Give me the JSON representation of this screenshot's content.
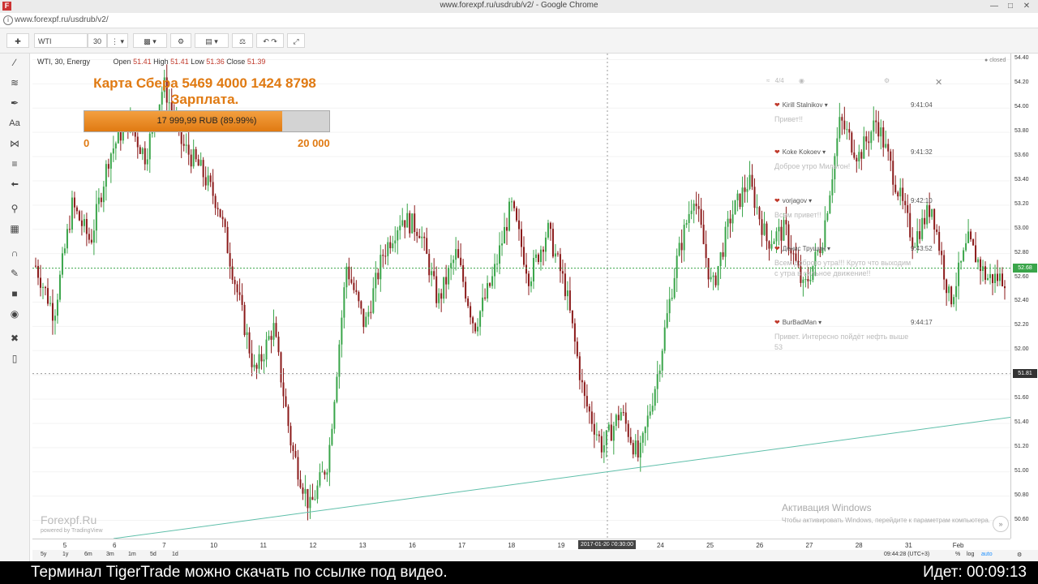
{
  "window": {
    "title": "www.forexpf.ru/usdrub/v2/ - Google Chrome",
    "url": "www.forexpf.ru/usdrub/v2/",
    "favicon": "F"
  },
  "toolbar": {
    "symbol": "WTI",
    "interval": "30"
  },
  "legend": {
    "title": "WTI, 30, Energy",
    "open_label": "Open",
    "open": "51.41",
    "high_label": "High",
    "high": "51.41",
    "low_label": "Low",
    "low": "51.36",
    "close_label": "Close",
    "close": "51.39",
    "status": "closed"
  },
  "overlay": {
    "line1": "Карта Сбера 5469 4000 1424 8798",
    "line2": "Зарплата.",
    "progress_text": "17 999,99 RUB (89.99%)",
    "progress_fraction": 0.8999,
    "min": "0",
    "max": "20 000"
  },
  "chat": {
    "header_count": "4/4",
    "messages": [
      {
        "name": "Kirill Stalnikov",
        "time": "9:41:04",
        "text": "Привет!!"
      },
      {
        "name": "Koke Kokoev",
        "time": "9:41:32",
        "text": "Доброе утро Мильтон!"
      },
      {
        "name": "vorjagov",
        "time": "9:42:10",
        "text": "Всем привет!!"
      },
      {
        "name": "Денис Трушин",
        "time": "9:43:52",
        "text": "Всем доброго утра!!! Круто что выходим с утра в сильное движение!!"
      },
      {
        "name": "BurBadMan",
        "time": "9:44:17",
        "text": "Привет. Интересно пойдёт нефть выше 53"
      }
    ]
  },
  "chart_data": {
    "type": "candlestick",
    "symbol": "WTI",
    "interval": "30",
    "ylim": [
      50.45,
      54.45
    ],
    "y_ticks": [
      "54.40",
      "54.20",
      "54.00",
      "53.80",
      "53.60",
      "53.40",
      "53.20",
      "53.00",
      "52.80",
      "52.60",
      "52.40",
      "52.20",
      "52.00",
      "51.80",
      "51.60",
      "51.40",
      "51.20",
      "51.00",
      "50.80",
      "50.60"
    ],
    "x_ticks": [
      "5",
      "6",
      "7",
      "10",
      "11",
      "12",
      "13",
      "16",
      "17",
      "18",
      "19",
      "23",
      "24",
      "25",
      "26",
      "27",
      "28",
      "31",
      "Feb"
    ],
    "crosshair_x_label": "2017-01-20 00:30:00",
    "last_price": "52.68",
    "cursor_price": "51.81",
    "close_path": [
      52.7,
      52.3,
      53.2,
      52.9,
      53.6,
      53.9,
      53.6,
      54.2,
      53.7,
      53.5,
      53.2,
      52.5,
      51.8,
      52.2,
      51.2,
      50.7,
      51.1,
      52.7,
      52.2,
      52.8,
      53.1,
      53.0,
      52.4,
      52.8,
      52.2,
      52.6,
      53.2,
      52.6,
      53.0,
      52.5,
      51.6,
      51.2,
      51.5,
      51.1,
      51.8,
      52.7,
      53.3,
      52.5,
      53.1,
      53.4,
      52.9,
      53.0,
      52.5,
      52.9,
      53.9,
      53.6,
      53.9,
      53.4,
      52.9,
      53.2,
      52.4,
      52.9,
      52.6,
      52.6
    ]
  },
  "timeframes": [
    "5y",
    "1y",
    "6m",
    "3m",
    "1m",
    "5d",
    "1d"
  ],
  "bottom_right": {
    "time": "09:44:28 (UTC+3)",
    "pct": "%",
    "log": "log",
    "auto": "auto"
  },
  "watermark": {
    "brand": "Forexpf.Ru",
    "powered": "powered by TradingView"
  },
  "windows_activation": {
    "title": "Активация Windows",
    "text": "Чтобы активировать Windows, перейдите к параметрам компьютера."
  },
  "caption": {
    "left": "Терминал TigerTrade можно скачать по ссылке под видео.",
    "right": "Идет: 00:09:13"
  },
  "colors": {
    "up": "#3aa54a",
    "down": "#8b1a1a",
    "accent": "#e07a12",
    "trend": "#5fbfaa"
  }
}
